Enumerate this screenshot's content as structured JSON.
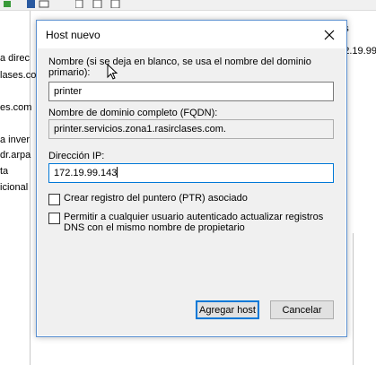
{
  "background": {
    "left_items": [
      "a direc",
      "lases.co",
      "es.com",
      "a inver",
      "dr.arpa",
      "ta",
      "icional"
    ],
    "column_header": "atos",
    "column_value": "172.19.99"
  },
  "dialog": {
    "title": "Host nuevo",
    "name_label": "Nombre (si se deja en blanco, se usa el nombre del dominio primario):",
    "name_value": "printer",
    "fqdn_label": "Nombre de dominio completo (FQDN):",
    "fqdn_value": "printer.servicios.zona1.rasirclases.com.",
    "ip_label": "Dirección IP:",
    "ip_value": "172.19.99.143",
    "ptr_label": "Crear registro del puntero (PTR) asociado",
    "ptr_checked": false,
    "auth_label": "Permitir a cualquier usuario autenticado actualizar registros DNS con el mismo nombre de propietario",
    "auth_checked": false,
    "add_button": "Agregar host",
    "cancel_button": "Cancelar"
  },
  "icons": [
    "close-icon",
    "mouse-cursor-icon",
    "toolbar-icons"
  ],
  "colors": {
    "dialog_border": "#5a8fd0",
    "focus_border": "#0078d7",
    "client_bg": "#f0f0f0"
  }
}
